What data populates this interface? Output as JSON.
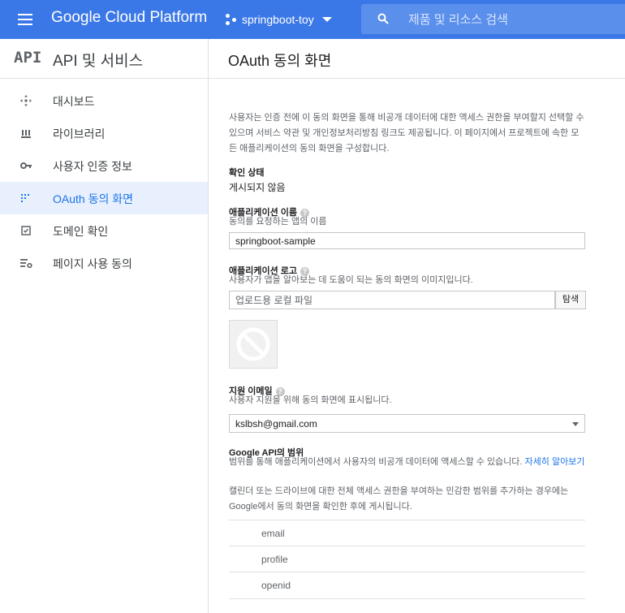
{
  "topbar": {
    "brand": "Google Cloud Platform",
    "project": "springboot-toy",
    "search_placeholder": "제품 및 리소스 검색"
  },
  "sidebar": {
    "logo": "API",
    "title": "API 및 서비스",
    "items": [
      {
        "label": "대시보드",
        "icon": "dashboard-icon"
      },
      {
        "label": "라이브러리",
        "icon": "library-icon"
      },
      {
        "label": "사용자 인증 정보",
        "icon": "key-icon"
      },
      {
        "label": "OAuth 동의 화면",
        "icon": "consent-icon",
        "active": true
      },
      {
        "label": "도메인 확인",
        "icon": "checkbox-icon"
      },
      {
        "label": "페이지 사용 동의",
        "icon": "settings-list-icon"
      }
    ]
  },
  "main": {
    "title": "OAuth 동의 화면",
    "intro": "사용자는 인증 전에 이 동의 화면을 통해 비공개 데이터에 대한 액세스 권한을 부여할지 선택할 수 있으며 서비스 약관 및 개인정보처리방침 링크도 제공됩니다. 이 페이지에서 프로젝트에 속한 모든 애플리케이션의 동의 화면을 구성합니다.",
    "status_label": "확인 상태",
    "status_value": "게시되지 않음",
    "app_name_label": "애플리케이션 이름",
    "app_name_desc": "동의를 요청하는 앱의 이름",
    "app_name_value": "springboot-sample",
    "app_logo_label": "애플리케이션 로고",
    "app_logo_desc": "사용자가 앱을 알아보는 데 도움이 되는 동의 화면의 이미지입니다.",
    "app_logo_placeholder": "업로드용 로컬 파일",
    "browse_label": "탐색",
    "support_email_label": "지원 이메일",
    "support_email_desc": "사용자 지원을 위해 동의 화면에 표시됩니다.",
    "support_email_value": "kslbsh@gmail.com",
    "scopes_label": "Google API의 범위",
    "scopes_desc": "범위를 통해 애플리케이션에서 사용자의 비공개 데이터에 액세스할 수 있습니다.",
    "scopes_link": "자세히 알아보기",
    "scopes_note": "캘린더 또는 드라이브에 대한 전체 액세스 권한을 부여하는 민감한 범위를 추가하는 경우에는 Google에서 동의 화면을 확인한 후에 게시됩니다.",
    "scopes": [
      "email",
      "profile",
      "openid"
    ],
    "help_glyph": "?"
  }
}
